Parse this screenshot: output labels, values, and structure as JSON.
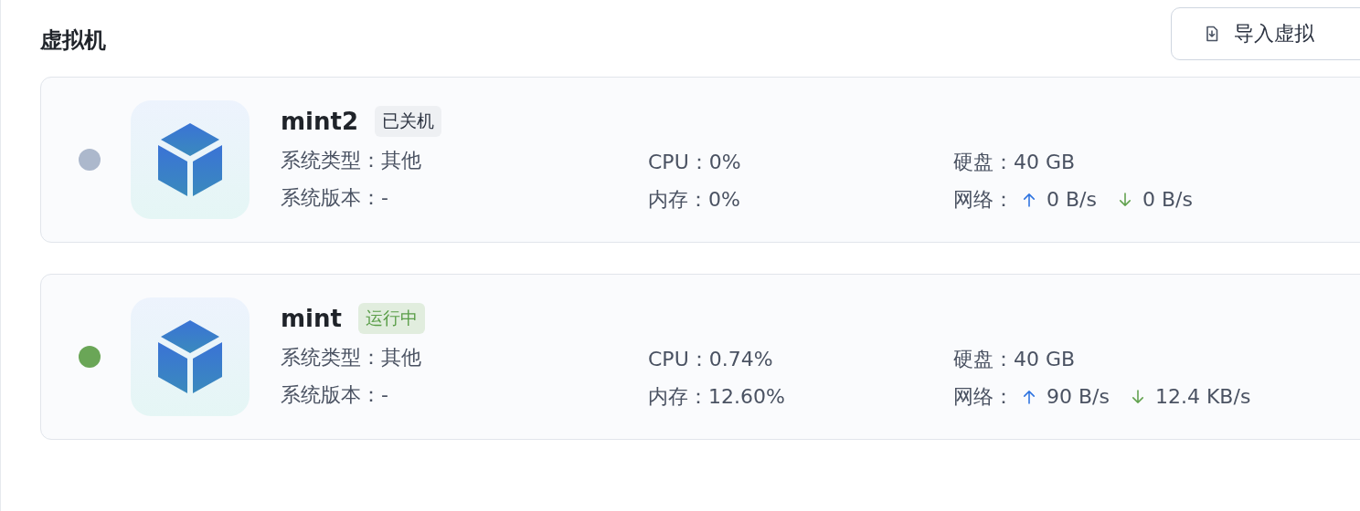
{
  "title": "虚拟机",
  "import_button": {
    "label": "导入虚拟"
  },
  "vms": [
    {
      "name": "mint2",
      "color": "#acb8cc",
      "status": {
        "label": "已关机",
        "kind": "stopped"
      },
      "os_type": {
        "label": "系统类型：",
        "value": "其他"
      },
      "os_version": {
        "label": "系统版本：",
        "value": "-"
      },
      "cpu": {
        "label": "CPU：",
        "value": "0%"
      },
      "memory": {
        "label": "内存：",
        "value": "0%"
      },
      "disk": {
        "label": "硬盘：",
        "value": "40 GB"
      },
      "network": {
        "label": "网络：",
        "up": "0 B/s",
        "down": "0 B/s"
      }
    },
    {
      "name": "mint",
      "color": "#6aa657",
      "status": {
        "label": "运行中",
        "kind": "running"
      },
      "os_type": {
        "label": "系统类型：",
        "value": "其他"
      },
      "os_version": {
        "label": "系统版本：",
        "value": "-"
      },
      "cpu": {
        "label": "CPU：",
        "value": "0.74%"
      },
      "memory": {
        "label": "内存：",
        "value": "12.60%"
      },
      "disk": {
        "label": "硬盘：",
        "value": "40 GB"
      },
      "network": {
        "label": "网络：",
        "up": "90 B/s",
        "down": "12.4 KB/s"
      }
    }
  ]
}
